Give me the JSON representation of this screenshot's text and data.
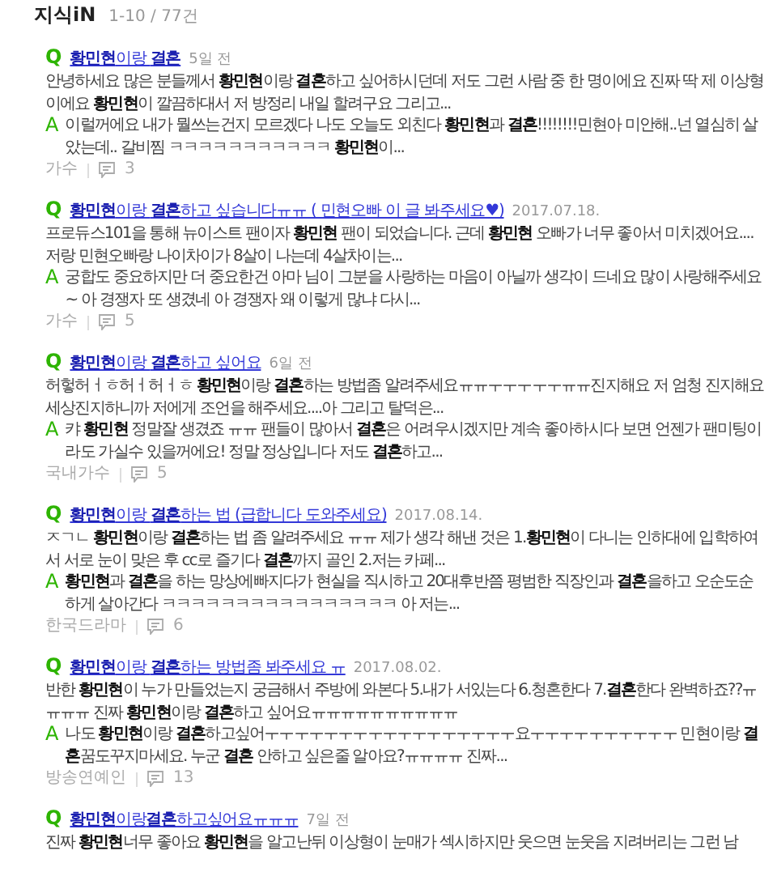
{
  "header": {
    "title": "지식iN",
    "count": "1-10 / 77건"
  },
  "results": [
    {
      "q_mark": "Q",
      "title": "**황민현**이랑 **결혼**",
      "date": "5일 전",
      "question": "안녕하세요 많은 분들께서 **황민현**이랑 **결혼**하고 싶어하시던데 저도 그런 사람 중 한 명이에요 진짜 딱 제 이상형이에요 **황민현**이 깔끔하대서 저 방정리 내일 할려구요 그리고...",
      "a_mark": "A",
      "answer": "이럴꺼에요 내가 뭘쓰는건지 모르겠다 나도 오늘도 외친다 **황민현**과 **결혼**!!!!!!!!민현아 미안해..넌 열심히 살았는데.. 갈비찜 ㅋㅋㅋㅋㅋㅋㅋㅋㅋㅋㅋ **황민현**이...",
      "category": "가수",
      "comments": "3"
    },
    {
      "q_mark": "Q",
      "title": "**황민현**이랑 **결혼**하고 싶습니다ㅠㅠ ( 민현오빠 이 글 봐주세요♥)",
      "date": "2017.07.18.",
      "question": "프로듀스101을 통해 뉴이스트 팬이자 **황민현** 팬이 되었습니다. 근데 **황민현** 오빠가 너무 좋아서 미치겠어요.... 저랑 민현오빠랑 나이차이가 8살이 나는데 4살차이는...",
      "a_mark": "A",
      "answer": "궁합도 중요하지만 더 중요한건 아마 님이 그분을 사랑하는 마음이 아닐까 생각이 드네요 많이 사랑해주세요~ 아 경쟁자 또 생겼네 아 경쟁자 왜 이렇게 많냐 다시...",
      "category": "가수",
      "comments": "5"
    },
    {
      "q_mark": "Q",
      "title": "**황민현**이랑 **결혼**하고 싶어요",
      "date": "6일 전",
      "question": "허헣허ㅓㅎ허ㅓ허ㅓㅎ **황민현**이랑 **결혼**하는 방법좀 알려주세요ㅠㅠㅜㅜㅜㅜㅜㅠㅠ진지해요 저 엄청 진지해요 세상진지하니까 저에게 조언을 해주세요....아 그리고 탈덕은...",
      "a_mark": "A",
      "answer": "캬 **황민현** 정말잘 생겼죠 ㅠㅠ 팬들이 많아서 **결혼**은 어려우시겠지만 계속 좋아하시다 보면 언젠가 팬미팅이라도 가실수 있을꺼에요! 정말 정상입니다 저도 **결혼**하고...",
      "category": "국내가수",
      "comments": "5"
    },
    {
      "q_mark": "Q",
      "title": "**황민현**이랑 **결혼**하는 법 (급합니다 도와주세요)",
      "date": "2017.08.14.",
      "question": "ㅈㄱㄴ **황민현**이랑 **결혼**하는 법 좀 알려주세요 ㅠㅠ 제가 생각 해낸 것은 1.**황민현**이 다니는 인하대에 입학하여서 서로 눈이 맞은 후 cc로 즐기다 **결혼**까지 골인 2.저는 카페...",
      "a_mark": "A",
      "answer": "**황민현**과 **결혼**을 하는 망상에빠지다가 현실을 직시하고 20대후반쯤 평범한 직장인과 **결혼**을하고 오순도순하게 살아간다 ㅋㅋㅋㅋㅋㅋㅋㅋㅋㅋㅋㅋㅋㅋㅋㅋ 아 저는...",
      "category": "한국드라마",
      "comments": "6"
    },
    {
      "q_mark": "Q",
      "title": "**황민현**이랑 **결혼**하는 방법좀 봐주세요 ㅠ",
      "date": "2017.08.02.",
      "question": "반한 **황민현**이 누가 만들었는지 궁금해서 주방에 와본다 5.내가 서있는다 6.청혼한다 7.**결혼**한다 완벽하죠??ㅠㅠㅠㅠ 진짜 **황민현**이랑 **결혼**하고 싶어요ㅠㅠㅠㅠㅠㅠㅠㅠㅠㅠ",
      "a_mark": "A",
      "answer": "나도 **황민현**이랑 **결혼**하고싶어ㅜㅜㅜㅜㅜㅜㅜㅜㅜㅜㅜㅜㅜㅜㅜㅜㅜ요ㅜㅜㅜㅜㅜㅜㅜㅜㅜㅜ 민현이랑 **결혼**꿈도꾸지마세요. 누군 **결혼** 안하고 싶은줄 알아요?ㅠㅠㅠㅠ 진짜...",
      "category": "방송연예인",
      "comments": "13"
    },
    {
      "q_mark": "Q",
      "title": "**황민현**이랑**결혼**하고싶어요ㅠㅠㅠ",
      "date": "7일 전",
      "question": "진짜 **황민현**너무 좋아요 **황민현**을 알고난뒤 이상형이 눈매가 섹시하지만 웃으면 눈웃음 지려버리는 그런 남"
    }
  ]
}
